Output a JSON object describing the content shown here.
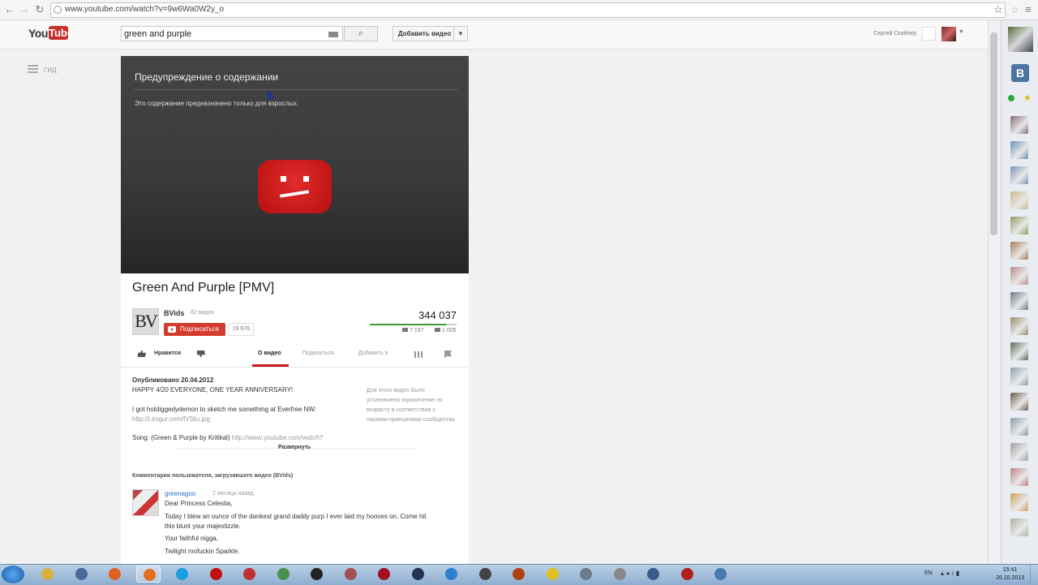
{
  "browser": {
    "url": "www.youtube.com/watch?v=9w6Wa0W2y_o"
  },
  "masthead": {
    "logo_you": "You",
    "logo_tube": "Tube",
    "search_value": "green and purple",
    "upload_label": "Добавить видео",
    "username": "Сергей Скайпер"
  },
  "guide": {
    "label": "ГИД"
  },
  "player": {
    "warning_title": "Предупреждение о содержании",
    "warning_text": "Это содержание предназначено только для взрослых."
  },
  "video": {
    "title": "Green And Purple [PMV]",
    "channel_avatar_text": "BV",
    "channel_name": "BVids",
    "channel_video_count": "62 видео",
    "subscribe_label": "Подписаться",
    "subscriber_count": "19 676",
    "views": "344 037",
    "like_ratio": 0.88,
    "likes": "7 197",
    "dislikes": "1 005"
  },
  "actions": {
    "like_label": "Нравится",
    "tabs": [
      "О видео",
      "Поделиться",
      "Добавить в"
    ],
    "active_tab": 0
  },
  "description": {
    "published": "Опубликовано 20.04.2012",
    "line1": "HAPPY 4/20 EVERYONE, ONE YEAR ANNIVERSARY!",
    "line2": "I got hotdiggedydemon to sketch me something at Everfree NW:",
    "line2_link": "http://i.imgur.com/fV5liu.jpg",
    "song_prefix": "Song: (Green & Purple by Kritikal)",
    "song_link": "http://www.youtube.com/watch?",
    "expand_label": "Развернуть",
    "side_note": "Для этого видео было установлено ограничение по возрасту в соответствии с нашими",
    "side_note_link": "принципами сообщества"
  },
  "comments": {
    "heading": "Комментарии пользователя, загрузившего видео (BVids)",
    "items": [
      {
        "user": "greenagoo",
        "time": "2 месяца назад",
        "lines": [
          "Dear Princess Celestia,",
          "Today I blew an ounce of the dankest grand daddy purp I ever laid my hooves on. Come hit",
          "this blunt your majestizzle.",
          "Your faithful nigga,",
          "Twilight mofuckin Sparkle."
        ]
      }
    ]
  },
  "vk_sidebar": {
    "logo": "B",
    "friend_colors": [
      "#8a6a7a",
      "#6a8fb8",
      "#7b95b5",
      "#c9b98a",
      "#8e9a5a",
      "#a87a5a",
      "#b88a8a",
      "#6a7a8a",
      "#9a8a6a",
      "#5a6a5a",
      "#8aa0b0",
      "#6a5a4a",
      "#8a9ab0",
      "#a0a0a0",
      "#c08080",
      "#d0a060",
      "#b0b0a0"
    ]
  },
  "taskbar": {
    "apps": [
      "explorer",
      "media",
      "firefox",
      "firefox-active",
      "skype",
      "red-circle",
      "bars",
      "green-folder",
      "dark-circle",
      "game-a",
      "red-game",
      "fc3",
      "blue-app",
      "mb",
      "fighter",
      "yellow-circle",
      "star-wars",
      "gear",
      "portraits",
      "red-portrait",
      "vault"
    ],
    "app_colors": [
      "#d8b040",
      "#4a6a9a",
      "#e06020",
      "#e07020",
      "#1aa0e0",
      "#c01010",
      "#c03030",
      "#4a9050",
      "#222222",
      "#a05050",
      "#a01020",
      "#223355",
      "#2a80d0",
      "#444444",
      "#b04010",
      "#e0c020",
      "#6a7a8a",
      "#888888",
      "#3a5a8a",
      "#b02020",
      "#4a7ab0"
    ],
    "lang": "EN",
    "time": "15:41",
    "date": "26.10.2013"
  }
}
